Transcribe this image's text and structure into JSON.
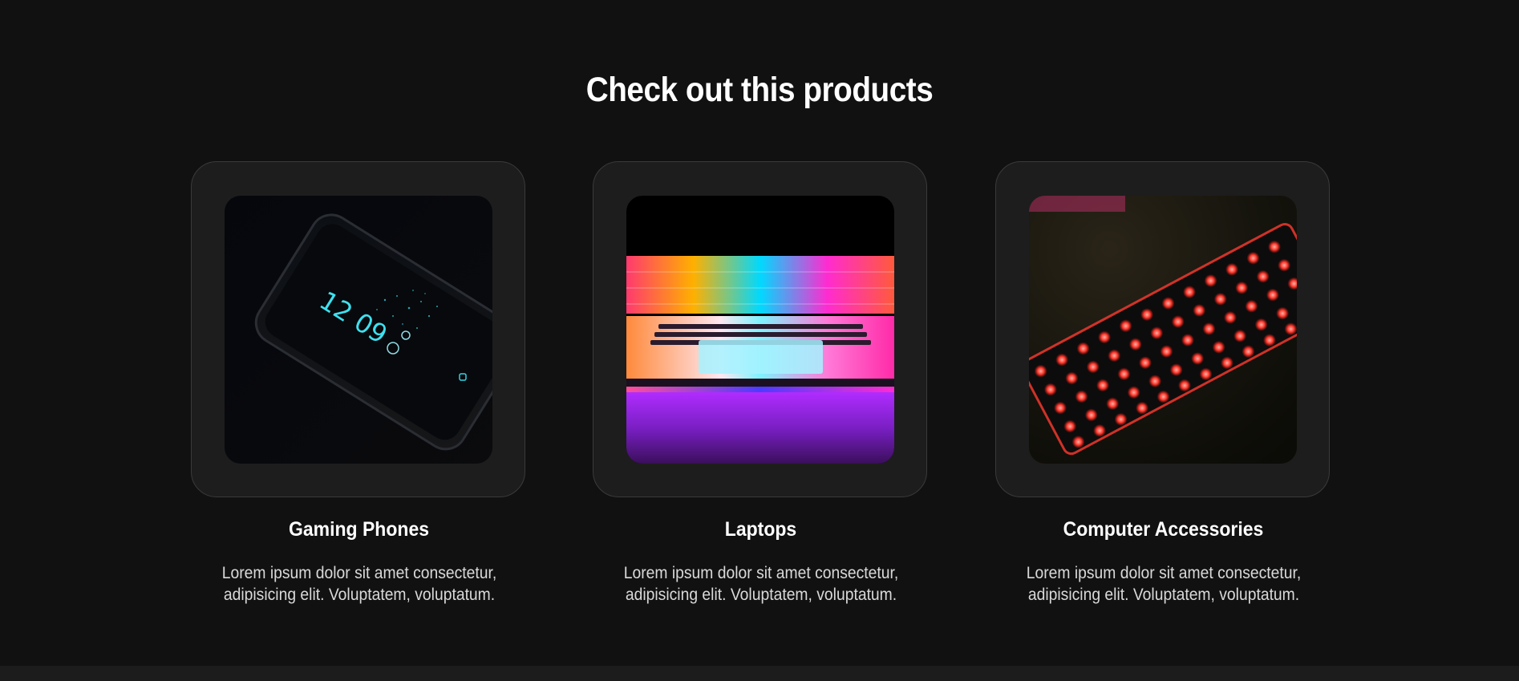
{
  "section": {
    "title": "Check out this products"
  },
  "products": [
    {
      "title": "Gaming Phones",
      "description": "Lorem ipsum dolor sit amet consectetur, adipisicing elit. Voluptatem, voluptatum.",
      "image": "phone-lockscreen-photo"
    },
    {
      "title": "Laptops",
      "description": "Lorem ipsum dolor sit amet consectetur, adipisicing elit. Voluptatem, voluptatum.",
      "image": "rgb-laptop-photo"
    },
    {
      "title": "Computer Accessories",
      "description": "Lorem ipsum dolor sit amet consectetur, adipisicing elit. Voluptatem, voluptatum.",
      "image": "red-backlit-keyboard-photo"
    }
  ],
  "phone_clock": "12 09",
  "colors": {
    "background": "#111111",
    "card_background": "#1d1d1d",
    "card_border": "#3a3a3a",
    "title": "#ffffff",
    "body_text": "#d9d9d9"
  }
}
